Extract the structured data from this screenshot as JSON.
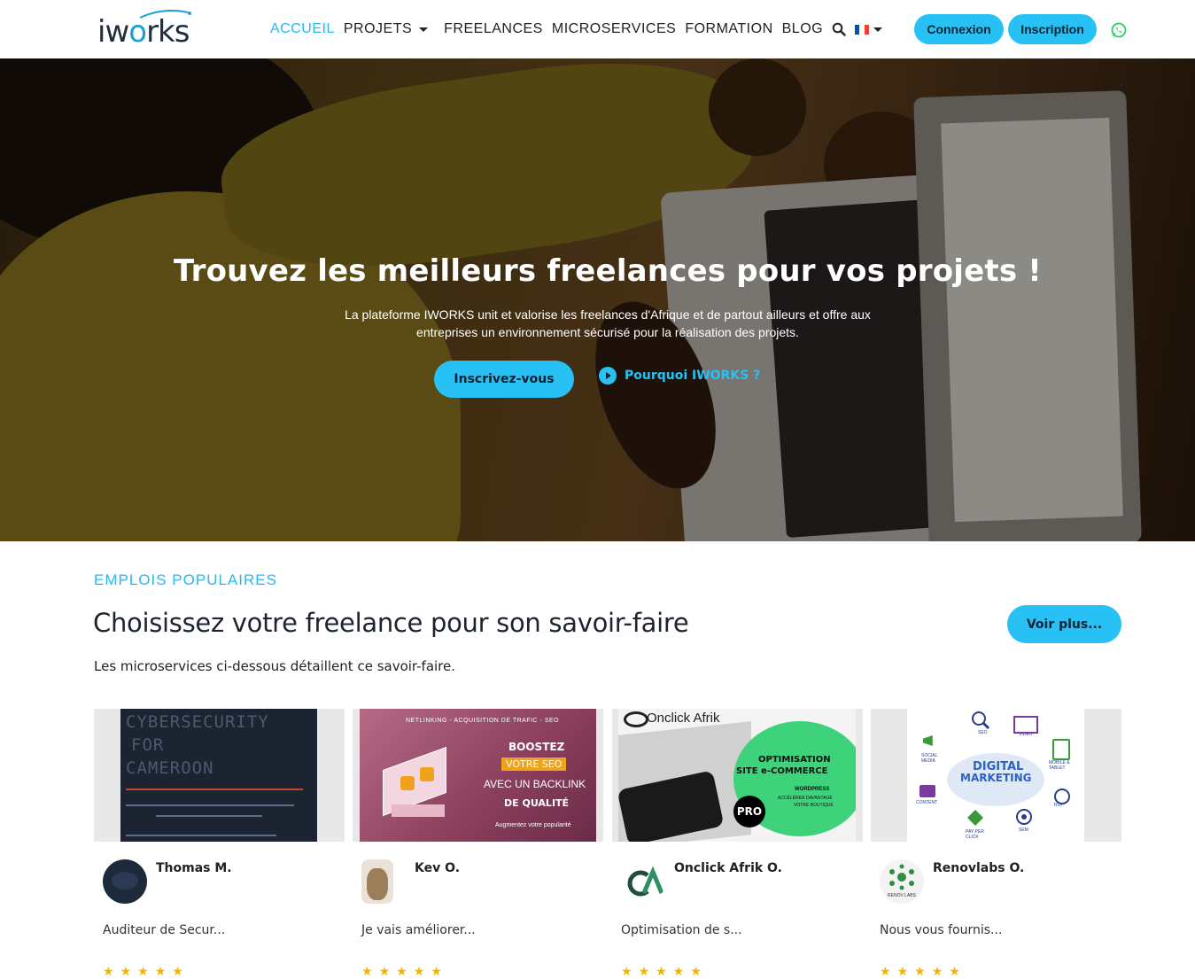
{
  "brand": {
    "logo_text": "iworks"
  },
  "nav": {
    "items": [
      {
        "label": "ACCUEIL",
        "active": true
      },
      {
        "label": "PROJETS",
        "dropdown": true
      },
      {
        "label": "FREELANCES"
      },
      {
        "label": "MICROSERVICES"
      },
      {
        "label": "FORMATION"
      },
      {
        "label": "BLOG"
      }
    ],
    "search_icon": "search-icon",
    "language_flag": "fr",
    "login_label": "Connexion",
    "signup_label": "Inscription",
    "whatsapp_icon": "whatsapp-icon"
  },
  "hero": {
    "title": "Trouvez les meilleurs freelances pour vos projets !",
    "subtitle": "La plateforme IWORKS unit et valorise les freelances d'Afrique et de partout ailleurs et offre aux entreprises un environnement sécurisé pour la réalisation des projets.",
    "cta_label": "Inscrivez-vous",
    "why_label": "Pourquoi IWORKS ?"
  },
  "section": {
    "eyebrow": "EMPLOIS POPULAIRES",
    "title": "Choisissez votre freelance pour son savoir-faire",
    "subtitle": "Les microservices ci-dessous détaillent ce savoir-faire.",
    "more_label": "Voir plus..."
  },
  "cards": [
    {
      "author": "Thomas M.",
      "desc": "Auditeur de Secur...",
      "rating": 5,
      "thumb_text": [
        "CYBERSECURITY",
        "FOR",
        "CAMEROON"
      ]
    },
    {
      "author": "Kev O.",
      "desc": "Je vais améliorer...",
      "rating": 5,
      "thumb_text": [
        "NETLINKING - ACQUISITION DE TRAFIC - SEO",
        "BOOSTEZ",
        "VOTRE SEO",
        "AVEC UN BACKLINK",
        "DE QUALITÉ",
        "Augmentez votre popularité"
      ]
    },
    {
      "author": "Onclick Afrik O.",
      "desc": "Optimisation de s...",
      "rating": 5,
      "thumb_text": [
        "Onclick Afrik",
        "OPTIMISATION",
        "SITE e-COMMERCE",
        "WORDPRESS",
        "ACCÉLÉRER DAVANTAGE",
        "VOTRE BOUTIQUE",
        "PRO"
      ]
    },
    {
      "author": "Renovlabs O.",
      "desc": "Nous vous fournis...",
      "rating": 5,
      "thumb_text": [
        "DIGITAL",
        "MARKETING",
        "SEO",
        "VIDEO",
        "SOCIAL MEDIA",
        "MOBILE & TABLET",
        "CONTENT",
        "ROI",
        "PAY PER CLICK",
        "SEM",
        "RENOV LABS"
      ]
    }
  ],
  "colors": {
    "accent": "#27c1f5",
    "active_nav": "#27b7f5",
    "heading": "#1d2430",
    "star": "#f5b301"
  }
}
